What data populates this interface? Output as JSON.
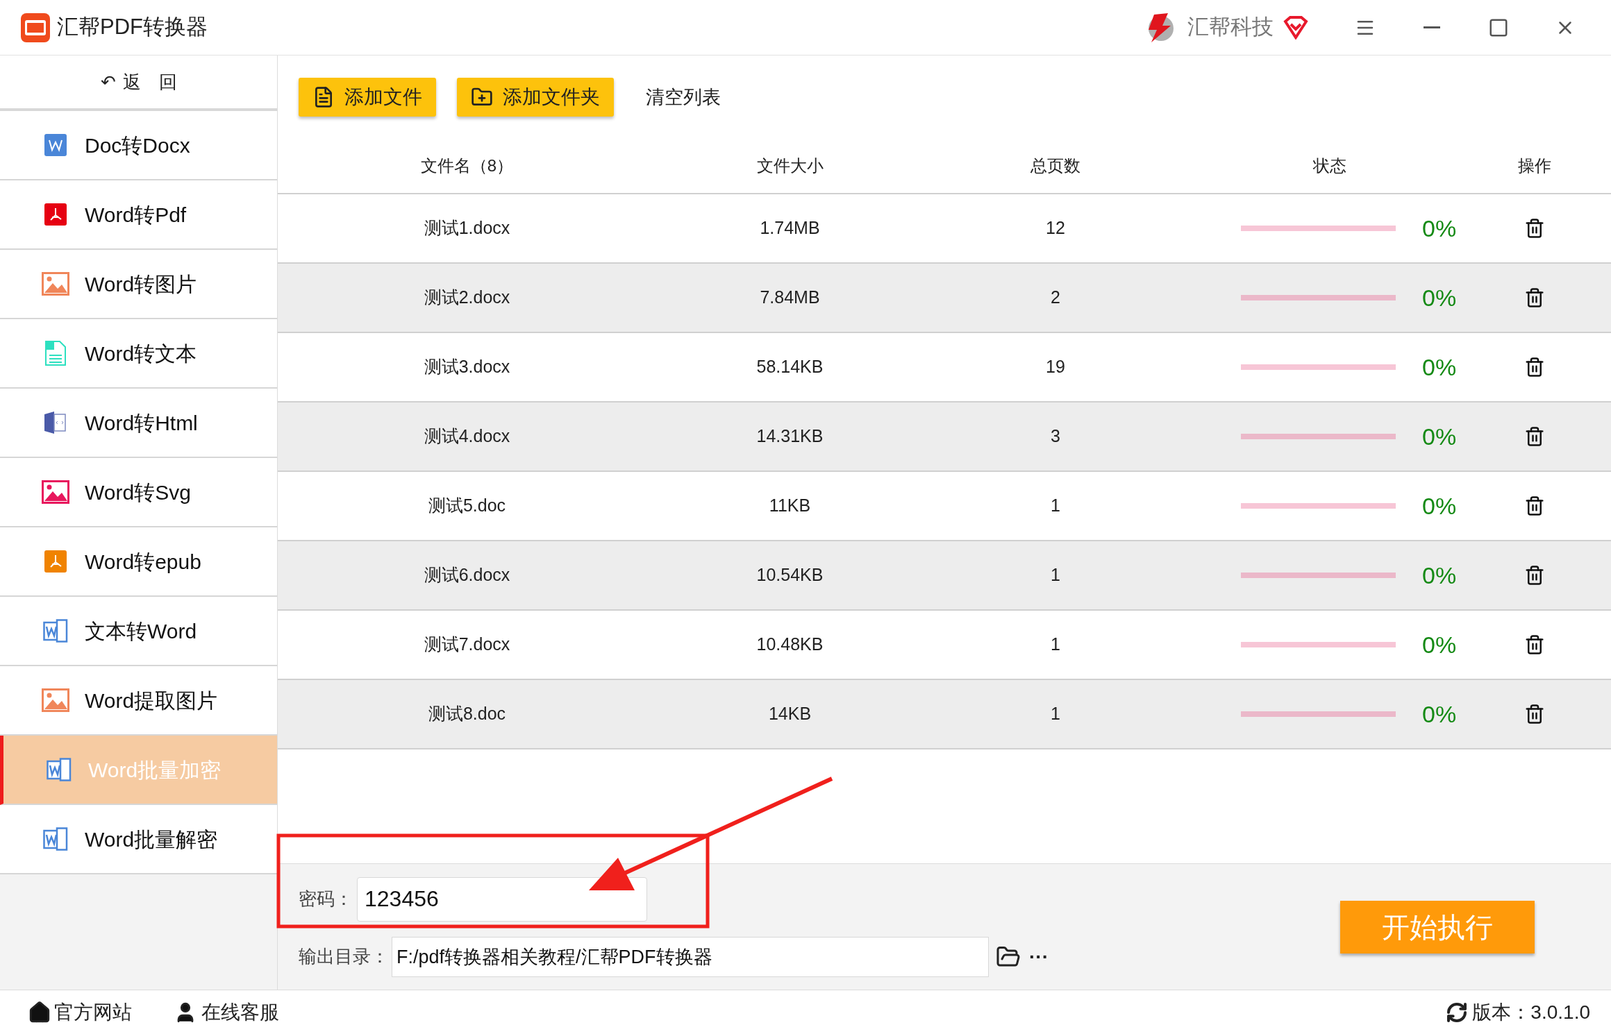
{
  "window": {
    "title": "汇帮PDF转换器",
    "brand": "汇帮科技"
  },
  "sidebar": {
    "back": {
      "icon": "↶",
      "label": "返　回"
    },
    "items": [
      {
        "label": "Doc转Docx",
        "kind": "word",
        "selected": false
      },
      {
        "label": "Word转Pdf",
        "kind": "pdf",
        "selected": false
      },
      {
        "label": "Word转图片",
        "kind": "image",
        "selected": false
      },
      {
        "label": "Word转文本",
        "kind": "text",
        "selected": false
      },
      {
        "label": "Word转Html",
        "kind": "html",
        "selected": false
      },
      {
        "label": "Word转Svg",
        "kind": "svg",
        "selected": false
      },
      {
        "label": "Word转epub",
        "kind": "epub",
        "selected": false
      },
      {
        "label": "文本转Word",
        "kind": "wordfile",
        "selected": false
      },
      {
        "label": "Word提取图片",
        "kind": "image",
        "selected": false
      },
      {
        "label": "Word批量加密",
        "kind": "wordfile",
        "selected": true
      },
      {
        "label": "Word批量解密",
        "kind": "wordfile",
        "selected": false
      }
    ]
  },
  "toolbar": {
    "add_file": "添加文件",
    "add_folder": "添加文件夹",
    "clear": "清空列表"
  },
  "table": {
    "columns": [
      "文件名（8）",
      "文件大小",
      "总页数",
      "状态",
      "操作"
    ],
    "rows": [
      {
        "name": "测试1.docx",
        "size": "1.74MB",
        "pages": "12",
        "level": 0,
        "percent": "0%"
      },
      {
        "name": "测试2.docx",
        "size": "7.84MB",
        "pages": "2",
        "level": 0,
        "percent": "0%"
      },
      {
        "name": "测试3.docx",
        "size": "58.14KB",
        "pages": "19",
        "level": 0,
        "percent": "0%"
      },
      {
        "name": "测试4.docx",
        "size": "14.31KB",
        "pages": "3",
        "level": 0,
        "percent": "0%"
      },
      {
        "name": "测试5.doc",
        "size": "11KB",
        "pages": "1",
        "level": 0,
        "percent": "0%"
      },
      {
        "name": "测试6.docx",
        "size": "10.54KB",
        "pages": "1",
        "level": 0,
        "percent": "0%"
      },
      {
        "name": "测试7.docx",
        "size": "10.48KB",
        "pages": "1",
        "level": 0,
        "percent": "0%"
      },
      {
        "name": "测试8.doc",
        "size": "14KB",
        "pages": "1",
        "level": 0,
        "percent": "0%"
      }
    ]
  },
  "settings": {
    "password_label": "密码：",
    "password": "123456",
    "output_label": "输出目录：",
    "output_path": "F:/pdf转换器相关教程/汇帮PDF转换器",
    "more": "···",
    "start": "开始执行"
  },
  "footer": {
    "website": "官方网站",
    "support": "在线客服",
    "version": "版本：3.0.1.0"
  }
}
